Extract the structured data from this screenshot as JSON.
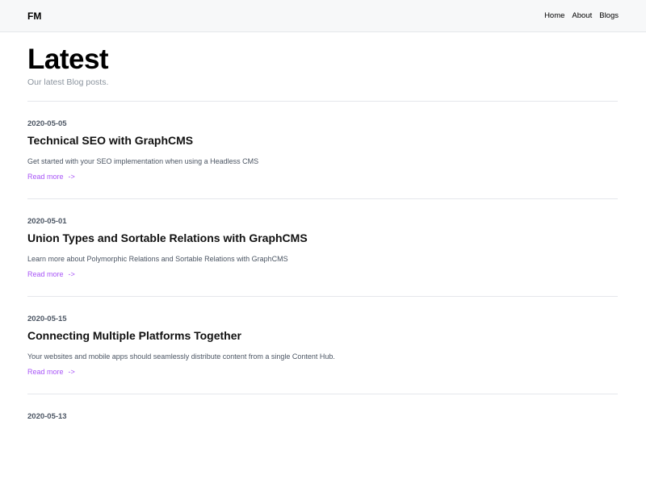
{
  "header": {
    "brand": "FM",
    "nav": [
      "Home",
      "About",
      "Blogs"
    ]
  },
  "main": {
    "title": "Latest",
    "subtitle": "Our latest Blog posts.",
    "read_more_label": "Read more",
    "read_more_arrow": "->",
    "posts": [
      {
        "date": "2020-05-05",
        "title": "Technical SEO with GraphCMS",
        "excerpt": "Get started with your SEO implementation when using a Headless CMS"
      },
      {
        "date": "2020-05-01",
        "title": "Union Types and Sortable Relations with GraphCMS",
        "excerpt": "Learn more about Polymorphic Relations and Sortable Relations with GraphCMS"
      },
      {
        "date": "2020-05-15",
        "title": "Connecting Multiple Platforms Together",
        "excerpt": "Your websites and mobile apps should seamlessly distribute content from a single Content Hub."
      },
      {
        "date": "2020-05-13",
        "title": "",
        "excerpt": ""
      }
    ]
  },
  "colors": {
    "accent": "#a855f7",
    "topbar_bg": "#f7f8f9",
    "muted_text": "#8b949e",
    "divider": "#e5e7eb"
  }
}
